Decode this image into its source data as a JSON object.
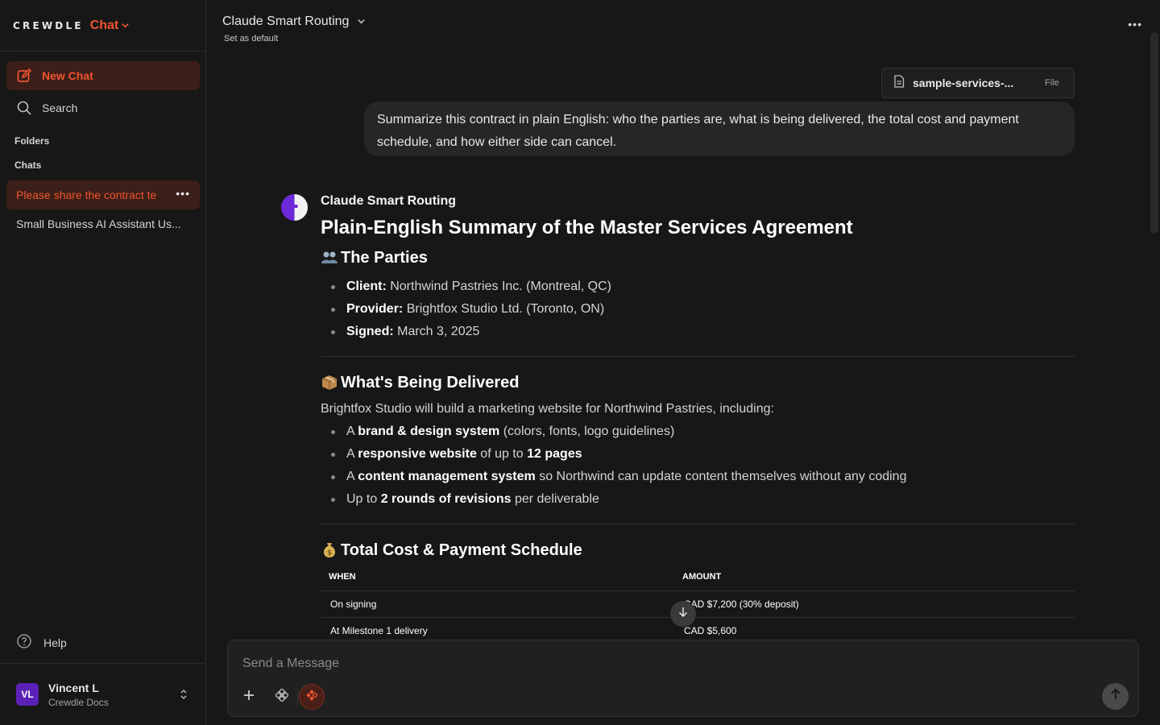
{
  "brand": {
    "logo": "CREWDLE",
    "product": "Chat"
  },
  "sidebar": {
    "new_chat": "New Chat",
    "search": "Search",
    "folders_label": "Folders",
    "chats_label": "Chats",
    "chats": [
      {
        "title": "Please share the contract te"
      },
      {
        "title": "Small Business AI Assistant Us..."
      }
    ],
    "help": "Help",
    "user": {
      "initials": "VL",
      "name": "Vincent L",
      "org": "Crewdle Docs"
    }
  },
  "header": {
    "model": "Claude Smart Routing",
    "set_default": "Set as default"
  },
  "attachment": {
    "name": "sample-services-...",
    "tag": "File"
  },
  "user_message": "Summarize this contract in plain English: who the parties are, what is being delivered, the total cost and payment schedule, and how either side can cancel.",
  "assistant": {
    "name": "Claude Smart Routing",
    "title": "Plain-English Summary of the Master Services Agreement",
    "parties": {
      "heading": "The Parties",
      "items": [
        {
          "label": "Client:",
          "text": " Northwind Pastries Inc. (Montreal, QC)"
        },
        {
          "label": "Provider:",
          "text": " Brightfox Studio Ltd. (Toronto, ON)"
        },
        {
          "label": "Signed:",
          "text": " March 3, 2025"
        }
      ]
    },
    "delivered": {
      "heading": "What's Being Delivered",
      "intro": "Brightfox Studio will build a marketing website for Northwind Pastries, including:",
      "item1": {
        "pre": "A ",
        "bold": "brand & design system",
        "post": " (colors, fonts, logo guidelines)"
      },
      "item2": {
        "pre": "A ",
        "bold": "responsive website",
        "mid": " of up to ",
        "bold2": "12 pages"
      },
      "item3": {
        "pre": "A ",
        "bold": "content management system",
        "post": " so Northwind can update content themselves without any coding"
      },
      "item4": {
        "pre": "Up to ",
        "bold": "2 rounds of revisions",
        "post": " per deliverable"
      }
    },
    "payment": {
      "heading": "Total Cost & Payment Schedule",
      "columns": [
        "WHEN",
        "AMOUNT"
      ],
      "rows": [
        [
          "On signing",
          "CAD $7,200 (30% deposit)"
        ],
        [
          "At Milestone 1 delivery",
          "CAD $5,600"
        ]
      ]
    }
  },
  "composer": {
    "placeholder": "Send a Message"
  },
  "colors": {
    "accent": "#f0542f",
    "background": "#171717",
    "avatar": "#5b21b6"
  }
}
